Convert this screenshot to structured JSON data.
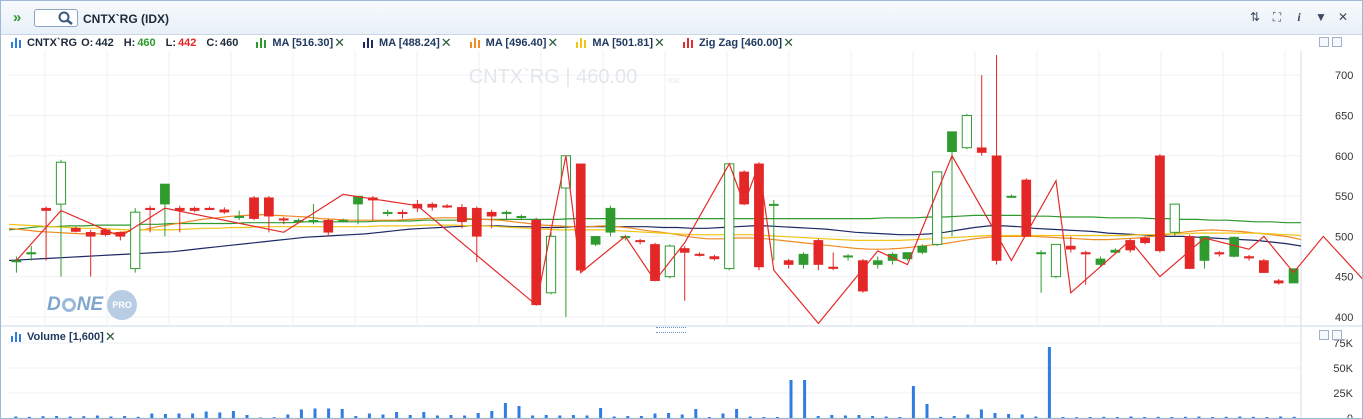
{
  "window": {
    "title": "CNTX`RG (IDX)",
    "search_value": ""
  },
  "legend": {
    "symbol": "CNTX`RG",
    "open_label": "O:",
    "open": "442",
    "high_label": "H:",
    "high": "460",
    "low_label": "L:",
    "low": "442",
    "close_label": "C:",
    "close": "460",
    "indicators": [
      {
        "label": "MA [516.30]",
        "color": "#2e9a2e"
      },
      {
        "label": "MA [488.24]",
        "color": "#1c2a66"
      },
      {
        "label": "MA [496.40]",
        "color": "#f08a24"
      },
      {
        "label": "MA [501.81]",
        "color": "#f2c418"
      },
      {
        "label": "Zig Zag [460.00]",
        "color": "#e52b2b"
      }
    ]
  },
  "watermark": "CNTX`RG | 460.00",
  "watermark_sub": "IDX",
  "logo": {
    "text1": "D",
    "text2": "NE",
    "badge": "PRO"
  },
  "volume_legend": "Volume [1,600]",
  "colors": {
    "up": "#2f9b2f",
    "down": "#e32626",
    "volume": "#2f7de0",
    "axis_text": "#333333"
  },
  "chart_data": {
    "type": "candlestick",
    "price_axis": {
      "ticks": [
        400,
        450,
        500,
        550,
        600,
        650,
        700
      ],
      "ylim": [
        390,
        730
      ]
    },
    "volume_axis": {
      "ticks": [
        "0",
        "25K",
        "50K",
        "75K"
      ],
      "ylim": [
        0,
        80000
      ]
    },
    "candles": [
      {
        "o": 470,
        "h": 475,
        "l": 455,
        "c": 470
      },
      {
        "o": 478,
        "h": 488,
        "l": 470,
        "c": 480
      },
      {
        "o": 535,
        "h": 537,
        "l": 470,
        "c": 532
      },
      {
        "o": 540,
        "h": 595,
        "l": 450,
        "c": 592
      },
      {
        "o": 510,
        "h": 512,
        "l": 505,
        "c": 506
      },
      {
        "o": 505,
        "h": 508,
        "l": 450,
        "c": 500
      },
      {
        "o": 508,
        "h": 510,
        "l": 500,
        "c": 502
      },
      {
        "o": 505,
        "h": 506,
        "l": 495,
        "c": 500
      },
      {
        "o": 460,
        "h": 535,
        "l": 455,
        "c": 530
      },
      {
        "o": 535,
        "h": 538,
        "l": 505,
        "c": 533
      },
      {
        "o": 540,
        "h": 565,
        "l": 500,
        "c": 565
      },
      {
        "o": 535,
        "h": 538,
        "l": 505,
        "c": 532
      },
      {
        "o": 535,
        "h": 537,
        "l": 530,
        "c": 532
      },
      {
        "o": 535,
        "h": 537,
        "l": 533,
        "c": 533
      },
      {
        "o": 533,
        "h": 536,
        "l": 528,
        "c": 530
      },
      {
        "o": 525,
        "h": 532,
        "l": 520,
        "c": 525
      },
      {
        "o": 548,
        "h": 550,
        "l": 520,
        "c": 522
      },
      {
        "o": 548,
        "h": 550,
        "l": 505,
        "c": 525
      },
      {
        "o": 522,
        "h": 524,
        "l": 515,
        "c": 520
      },
      {
        "o": 520,
        "h": 522,
        "l": 518,
        "c": 520
      },
      {
        "o": 520,
        "h": 540,
        "l": 515,
        "c": 520
      },
      {
        "o": 520,
        "h": 522,
        "l": 500,
        "c": 505
      },
      {
        "o": 520,
        "h": 522,
        "l": 518,
        "c": 520
      },
      {
        "o": 540,
        "h": 550,
        "l": 515,
        "c": 550
      },
      {
        "o": 548,
        "h": 550,
        "l": 520,
        "c": 545
      },
      {
        "o": 530,
        "h": 533,
        "l": 525,
        "c": 530
      },
      {
        "o": 530,
        "h": 533,
        "l": 522,
        "c": 528
      },
      {
        "o": 540,
        "h": 545,
        "l": 530,
        "c": 535
      },
      {
        "o": 540,
        "h": 542,
        "l": 532,
        "c": 536
      },
      {
        "o": 538,
        "h": 540,
        "l": 535,
        "c": 537
      },
      {
        "o": 536,
        "h": 540,
        "l": 510,
        "c": 518
      },
      {
        "o": 535,
        "h": 537,
        "l": 468,
        "c": 500
      },
      {
        "o": 530,
        "h": 533,
        "l": 510,
        "c": 525
      },
      {
        "o": 530,
        "h": 532,
        "l": 520,
        "c": 530
      },
      {
        "o": 525,
        "h": 527,
        "l": 520,
        "c": 525
      },
      {
        "o": 520,
        "h": 523,
        "l": 415,
        "c": 415
      },
      {
        "o": 430,
        "h": 505,
        "l": 428,
        "c": 500
      },
      {
        "o": 560,
        "h": 600,
        "l": 400,
        "c": 600
      },
      {
        "o": 590,
        "h": 590,
        "l": 455,
        "c": 458
      },
      {
        "o": 490,
        "h": 500,
        "l": 488,
        "c": 500
      },
      {
        "o": 505,
        "h": 538,
        "l": 500,
        "c": 535
      },
      {
        "o": 500,
        "h": 502,
        "l": 495,
        "c": 500
      },
      {
        "o": 495,
        "h": 497,
        "l": 490,
        "c": 494
      },
      {
        "o": 490,
        "h": 492,
        "l": 445,
        "c": 445
      },
      {
        "o": 450,
        "h": 490,
        "l": 448,
        "c": 488
      },
      {
        "o": 485,
        "h": 488,
        "l": 420,
        "c": 480
      },
      {
        "o": 478,
        "h": 480,
        "l": 475,
        "c": 477
      },
      {
        "o": 475,
        "h": 477,
        "l": 470,
        "c": 472
      },
      {
        "o": 460,
        "h": 590,
        "l": 458,
        "c": 590
      },
      {
        "o": 580,
        "h": 582,
        "l": 540,
        "c": 540
      },
      {
        "o": 590,
        "h": 592,
        "l": 458,
        "c": 462
      },
      {
        "o": 540,
        "h": 545,
        "l": 470,
        "c": 540
      },
      {
        "o": 470,
        "h": 472,
        "l": 460,
        "c": 465
      },
      {
        "o": 465,
        "h": 480,
        "l": 460,
        "c": 478
      },
      {
        "o": 495,
        "h": 497,
        "l": 458,
        "c": 465
      },
      {
        "o": 462,
        "h": 480,
        "l": 458,
        "c": 460
      },
      {
        "o": 475,
        "h": 478,
        "l": 470,
        "c": 476
      },
      {
        "o": 470,
        "h": 472,
        "l": 430,
        "c": 432
      },
      {
        "o": 465,
        "h": 475,
        "l": 460,
        "c": 470
      },
      {
        "o": 470,
        "h": 480,
        "l": 465,
        "c": 478
      },
      {
        "o": 472,
        "h": 480,
        "l": 470,
        "c": 480
      },
      {
        "o": 480,
        "h": 490,
        "l": 478,
        "c": 488
      },
      {
        "o": 490,
        "h": 580,
        "l": 488,
        "c": 580
      },
      {
        "o": 605,
        "h": 630,
        "l": 500,
        "c": 630
      },
      {
        "o": 610,
        "h": 652,
        "l": 608,
        "c": 650
      },
      {
        "o": 610,
        "h": 700,
        "l": 600,
        "c": 604
      },
      {
        "o": 600,
        "h": 725,
        "l": 465,
        "c": 470
      },
      {
        "o": 550,
        "h": 552,
        "l": 548,
        "c": 550
      },
      {
        "o": 570,
        "h": 572,
        "l": 500,
        "c": 500
      },
      {
        "o": 480,
        "h": 483,
        "l": 430,
        "c": 480
      },
      {
        "o": 450,
        "h": 490,
        "l": 448,
        "c": 490
      },
      {
        "o": 488,
        "h": 500,
        "l": 480,
        "c": 484
      },
      {
        "o": 480,
        "h": 482,
        "l": 440,
        "c": 478
      },
      {
        "o": 465,
        "h": 475,
        "l": 463,
        "c": 472
      },
      {
        "o": 480,
        "h": 485,
        "l": 478,
        "c": 483
      },
      {
        "o": 495,
        "h": 497,
        "l": 480,
        "c": 483
      },
      {
        "o": 498,
        "h": 500,
        "l": 490,
        "c": 492
      },
      {
        "o": 600,
        "h": 602,
        "l": 480,
        "c": 482
      },
      {
        "o": 505,
        "h": 540,
        "l": 500,
        "c": 540
      },
      {
        "o": 500,
        "h": 502,
        "l": 460,
        "c": 460
      },
      {
        "o": 470,
        "h": 500,
        "l": 460,
        "c": 500
      },
      {
        "o": 480,
        "h": 482,
        "l": 475,
        "c": 478
      },
      {
        "o": 475,
        "h": 500,
        "l": 474,
        "c": 499
      },
      {
        "o": 475,
        "h": 477,
        "l": 470,
        "c": 473
      },
      {
        "o": 470,
        "h": 472,
        "l": 455,
        "c": 455
      },
      {
        "o": 445,
        "h": 447,
        "l": 440,
        "c": 442
      },
      {
        "o": 442,
        "h": 460,
        "l": 442,
        "c": 460
      }
    ],
    "ma": [
      {
        "name": "MA [516.30]",
        "values": [
          508,
          510,
          512,
          512,
          513,
          513,
          514,
          514,
          514,
          515,
          515,
          516,
          516,
          516,
          516,
          516,
          517,
          517,
          517,
          517,
          518,
          518,
          518,
          518,
          518,
          519,
          519,
          519,
          520,
          520,
          520,
          521,
          521,
          521,
          521,
          521,
          521,
          521,
          522,
          522,
          522,
          522,
          522,
          522,
          522,
          522,
          522,
          522,
          522,
          522,
          522,
          522,
          522,
          522,
          522,
          522,
          522,
          522,
          522,
          523,
          523,
          523,
          524,
          524,
          525,
          526,
          526,
          526,
          526,
          525,
          525,
          524,
          524,
          524,
          523,
          523,
          523,
          522,
          522,
          521,
          521,
          520,
          520,
          519,
          518,
          518,
          517,
          517
        ]
      },
      {
        "name": "MA [488.24]",
        "values": [
          470,
          471,
          472,
          473,
          474,
          475,
          476,
          477,
          478,
          479,
          480,
          481,
          483,
          485,
          487,
          489,
          491,
          493,
          495,
          497,
          499,
          500,
          501,
          502,
          503,
          505,
          507,
          509,
          510,
          511,
          512,
          513,
          513,
          513,
          512,
          512,
          511,
          511,
          512,
          512,
          512,
          512,
          512,
          512,
          511,
          511,
          510,
          510,
          511,
          512,
          513,
          513,
          512,
          511,
          510,
          509,
          507,
          505,
          504,
          503,
          502,
          502,
          503,
          505,
          508,
          511,
          513,
          513,
          512,
          510,
          509,
          508,
          507,
          506,
          504,
          503,
          502,
          501,
          500,
          500,
          499,
          498,
          497,
          496,
          495,
          493,
          491,
          488
        ]
      },
      {
        "name": "MA [496.40]",
        "values": [
          510,
          508,
          506,
          505,
          504,
          503,
          503,
          504,
          506,
          508,
          512,
          515,
          518,
          521,
          523,
          525,
          526,
          527,
          526,
          525,
          524,
          522,
          521,
          520,
          520,
          520,
          520,
          521,
          522,
          523,
          523,
          522,
          521,
          520,
          518,
          516,
          514,
          513,
          512,
          512,
          513,
          512,
          510,
          507,
          505,
          502,
          499,
          497,
          497,
          498,
          498,
          497,
          495,
          493,
          491,
          489,
          487,
          485,
          484,
          484,
          485,
          487,
          489,
          491,
          494,
          497,
          499,
          500,
          500,
          500,
          499,
          498,
          497,
          496,
          496,
          497,
          498,
          500,
          502,
          505,
          507,
          508,
          507,
          506,
          504,
          502,
          500,
          496
        ]
      },
      {
        "name": "MA [501.81]",
        "values": [
          515,
          514,
          513,
          512,
          511,
          510,
          510,
          509,
          508,
          508,
          508,
          508,
          509,
          510,
          510,
          511,
          511,
          512,
          512,
          512,
          512,
          512,
          512,
          512,
          512,
          513,
          513,
          513,
          514,
          514,
          514,
          513,
          513,
          512,
          511,
          510,
          509,
          508,
          508,
          508,
          508,
          507,
          506,
          505,
          504,
          503,
          502,
          502,
          502,
          502,
          502,
          501,
          500,
          499,
          498,
          497,
          496,
          495,
          495,
          495,
          495,
          496,
          497,
          498,
          499,
          500,
          501,
          501,
          501,
          501,
          501,
          501,
          501,
          501,
          501,
          501,
          502,
          502,
          503,
          503,
          504,
          504,
          504,
          504,
          504,
          503,
          502,
          501
        ]
      }
    ],
    "zigzag": [
      [
        0,
        470
      ],
      [
        3,
        532
      ],
      [
        7,
        500
      ],
      [
        10,
        535
      ],
      [
        18,
        505
      ],
      [
        22,
        552
      ],
      [
        27,
        538
      ],
      [
        35,
        415
      ],
      [
        37,
        600
      ],
      [
        38,
        455
      ],
      [
        41,
        500
      ],
      [
        43,
        445
      ],
      [
        45,
        492
      ],
      [
        48,
        590
      ],
      [
        49,
        540
      ],
      [
        50,
        590
      ],
      [
        51,
        458
      ],
      [
        54,
        392
      ],
      [
        58,
        482
      ],
      [
        60,
        465
      ],
      [
        63,
        600
      ],
      [
        67,
        470
      ],
      [
        70,
        569
      ],
      [
        71,
        430
      ],
      [
        75,
        495
      ],
      [
        77,
        450
      ],
      [
        80,
        498
      ],
      [
        83,
        484
      ],
      [
        84,
        500
      ],
      [
        86,
        455
      ],
      [
        88,
        500
      ],
      [
        91,
        440
      ],
      [
        94,
        460
      ]
    ],
    "volume": [
      1500,
      1200,
      1800,
      2000,
      1500,
      1800,
      2500,
      1500,
      2000,
      1200,
      4500,
      4000,
      4500,
      4500,
      6500,
      5500,
      7000,
      3000,
      500,
      800,
      3500,
      8500,
      9500,
      9500,
      9000,
      2000,
      4500,
      3500,
      6000,
      3000,
      6000,
      2500,
      3000,
      2500,
      5000,
      7000,
      15000,
      12000,
      2500,
      3000,
      2500,
      3000,
      2500,
      10000,
      1500,
      2000,
      2000,
      4500,
      5000,
      3500,
      9000,
      1000,
      4500,
      9000,
      1500,
      1000,
      1000,
      38000,
      38000,
      2000,
      3000,
      2500,
      3000,
      2000,
      1500,
      1000,
      32000,
      14000,
      1200,
      2000,
      3500,
      8500,
      5000,
      4000,
      3500,
      1500,
      71000,
      1000,
      800,
      1000,
      1200,
      1000,
      1500,
      1000,
      1200,
      1000,
      1200,
      1500,
      1000,
      1200,
      1500,
      1200,
      1000,
      1500,
      1200
    ]
  }
}
